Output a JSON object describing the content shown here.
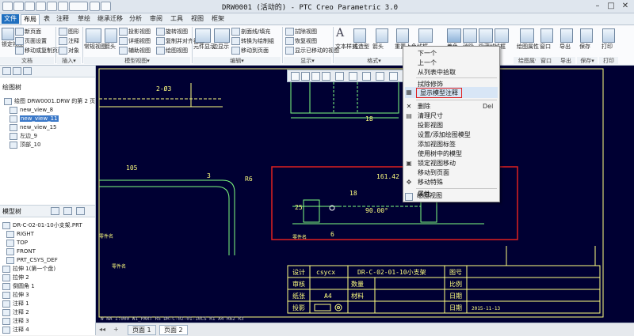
{
  "window": {
    "title": "DRW0001 (活动的) - PTC Creo Parametric 3.0",
    "minimize": "–",
    "maximize": "□",
    "close": "✕"
  },
  "tabs": [
    "文件",
    "布局",
    "表",
    "注释",
    "草绘",
    "继承迁移",
    "分析",
    "审阅",
    "工具",
    "视图",
    "框架"
  ],
  "ribbon": {
    "groups": [
      "文档",
      "插入▾",
      "模型视图▾",
      "编辑▾",
      "显示▾",
      "格式▾",
      "绘图属性",
      "窗口",
      "导出",
      "保存▾",
      "打印"
    ],
    "doc": {
      "items": [
        "新页面",
        "页面设置",
        "移动或复制页面"
      ],
      "large": [
        "锁定视图",
        "绘图模型"
      ]
    },
    "insert": {
      "items": [
        "图形",
        "注释",
        "对象"
      ]
    },
    "model_view": {
      "large": [
        "常规视图",
        "箭头"
      ],
      "items": [
        "投影视图",
        "详细视图",
        "辅助视图",
        "旋转视图",
        "复制并对齐视图",
        "绘图视图"
      ]
    },
    "edit": {
      "large": [
        "元件显示",
        "边显示"
      ],
      "items": [
        "剖面线/填充",
        "转换为绘制组",
        "移动到页面"
      ]
    },
    "display": {
      "items": [
        "拭除视图",
        "恢复视图",
        "显示已移动的视图"
      ]
    },
    "format": {
      "large": [
        "文本样式",
        "线造型",
        "箭头",
        "重置上色"
      ]
    },
    "view_buttons": [
      "线框",
      "着色",
      "消隐",
      "隐藏线",
      "线框",
      "更新页面"
    ],
    "right": [
      "绘图属性",
      "窗口",
      "导出",
      "保存",
      "打印"
    ]
  },
  "sidebar": {
    "tree_title": "绘图树",
    "tree_root": "绘图 DRW0001.DRW 的第 2 页",
    "tree_items": [
      "new_view_8",
      "new_view_11",
      "new_view_15",
      "左边_9",
      "顶部_10"
    ],
    "model_tree_title": "模型树",
    "model_root": "DR-C-02-01-10小支架.PRT",
    "model_items": [
      "RIGHT",
      "TOP",
      "FRONT",
      "PRT_CSYS_DEF",
      "拉伸 1(第一个盘)",
      "拉伸 2",
      "倒圆角 1",
      "拉伸 3",
      "注释 1",
      "注释 2",
      "注释 3",
      "注释 4"
    ]
  },
  "context_menu": {
    "items": [
      "下一个",
      "上一个",
      "从列表中拾取",
      "拭除修饰",
      "显示模型注释",
      "删除",
      "清理尺寸",
      "投影视图",
      "设置/添加绘图模型",
      "添加视图标签",
      "使用树中的模型",
      "锁定视图移动",
      "移动到页面",
      "移动特殊",
      "属性",
      "绘图视图"
    ],
    "shortcut_delete": "Del",
    "highlighted": "显示模型注释"
  },
  "drawing": {
    "dims": [
      "2-Ø3",
      "18",
      "105",
      "3",
      "R6",
      "161.42",
      "25",
      "18",
      "90.00°",
      "6"
    ],
    "labels": [
      "零件名",
      "零件名",
      "零件名"
    ],
    "status_strip": "W NA 1:000   W1_PART  R5 DR-C-02-01-10CS   R1 A4   R62 R3",
    "title_block": {
      "design_label": "设计",
      "design_value": "csycx",
      "drawing_name": "DR-C-02-01-10小支架",
      "drawing_no_label": "图号",
      "review_label": "审核",
      "qty_label": "数量",
      "scale_label": "比例",
      "paper_label": "纸张",
      "paper_value": "A4",
      "material_label": "材料",
      "date_label": "日期",
      "proj_label": "投影",
      "date_label2": "日期",
      "date_value": "2015-11-13"
    }
  },
  "sheet_tabs": [
    "页面 1",
    "页面 2"
  ],
  "colors": {
    "canvas_bg": "#000033",
    "cad_yellow": "#ffff80",
    "cad_green": "#80ff80",
    "cad_white": "#ffffff",
    "highlight_red": "#e02020",
    "accent": "#1f6fbf"
  }
}
